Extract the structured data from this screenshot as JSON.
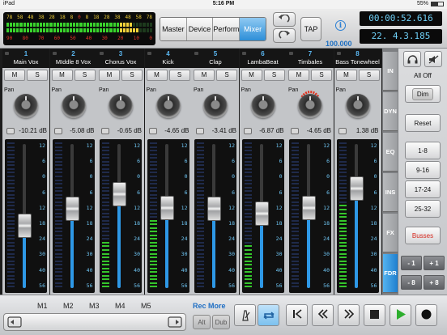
{
  "status_bar": {
    "device": "iPad",
    "time": "5:16 PM",
    "battery": "55%"
  },
  "top_meter": {
    "upper_labels": [
      "78",
      "58",
      "48",
      "38",
      "28",
      "18",
      "8",
      "0",
      "8",
      "18",
      "28",
      "38",
      "48",
      "58",
      "78"
    ],
    "lower_labels": [
      "90",
      "80",
      "70",
      "60",
      "50",
      "40",
      "30",
      "20",
      "10",
      "0"
    ],
    "colors": {
      "green": "#39d42c",
      "yellow": "#f3d23a",
      "red": "#e5382a",
      "off": "#1d3a1d"
    }
  },
  "view_tabs": [
    {
      "label": "Master",
      "active": false
    },
    {
      "label": "Device",
      "active": false
    },
    {
      "label": "Perform",
      "active": false
    },
    {
      "label": "Mixer",
      "active": true
    }
  ],
  "undo_icon": "undo-icon",
  "redo_icon": "redo-icon",
  "tap_label": "TAP",
  "info_glyph": "i",
  "tempo": "100.000",
  "time_display": "00:00:52.616",
  "bar_display": "22. 4.3.185",
  "channels": [
    {
      "number": "1",
      "name": "Main Vox",
      "gain": "-10.21 dB",
      "fader": 0.42,
      "level": 0.0,
      "knob_active": false
    },
    {
      "number": "2",
      "name": "MIddle 8 Vox",
      "gain": "-5.08 dB",
      "fader": 0.56,
      "level": 0.0,
      "knob_active": false
    },
    {
      "number": "3",
      "name": "Chorus Vox",
      "gain": "-0.65 dB",
      "fader": 0.68,
      "level": 0.31,
      "knob_active": false
    },
    {
      "number": "4",
      "name": "Kick",
      "gain": "-4.65 dB",
      "fader": 0.57,
      "level": 0.46,
      "knob_active": false
    },
    {
      "number": "5",
      "name": "Clap",
      "gain": "-3.41 dB",
      "fader": 0.56,
      "level": 0.0,
      "knob_active": false
    },
    {
      "number": "6",
      "name": "LambaBeat",
      "gain": "-6.87 dB",
      "fader": 0.52,
      "level": 0.28,
      "knob_active": false
    },
    {
      "number": "7",
      "name": "Timbales",
      "gain": "-4.65 dB",
      "fader": 0.57,
      "level": 0.0,
      "knob_active": true
    },
    {
      "number": "8",
      "name": "Bass Tonewheel",
      "gain": "1.38 dB",
      "fader": 0.73,
      "level": 0.57,
      "knob_active": false
    }
  ],
  "strip_labels": {
    "mute": "M",
    "solo": "S",
    "pan": "Pan"
  },
  "fader_scale": [
    "12",
    "6",
    "0",
    "6",
    "12",
    "18",
    "24",
    "30",
    "40",
    "56"
  ],
  "side_tabs": [
    {
      "label": "IN",
      "active": false
    },
    {
      "label": "DYN",
      "active": false
    },
    {
      "label": "EQ",
      "active": false
    },
    {
      "label": "INS",
      "active": false
    },
    {
      "label": "FX",
      "active": false
    },
    {
      "label": "FDR",
      "active": true
    }
  ],
  "right_panel": {
    "headphones_icon": "headphones-icon",
    "mute_speaker_icon": "speaker-mute-icon",
    "all_off": "All Off",
    "dim": "Dim",
    "reset": "Reset",
    "ranges": [
      "1-8",
      "9-16",
      "17-24",
      "25-32"
    ],
    "busses": "Busses",
    "nudge": [
      "- 1",
      "+ 1",
      "- 8",
      "+ 8"
    ],
    "busses_color": "#d6281e"
  },
  "bottom": {
    "markers": [
      "M1",
      "M2",
      "M3",
      "M4",
      "M5"
    ],
    "rec_more": "Rec More",
    "alt": "Alt",
    "dub": "Dub",
    "metronome_icon": "metronome-icon",
    "loop_icon": "loop-icon",
    "transport_icons": [
      "go-to-start-icon",
      "rewind-icon",
      "fast-forward-icon",
      "stop-icon",
      "play-icon",
      "record-icon"
    ]
  }
}
